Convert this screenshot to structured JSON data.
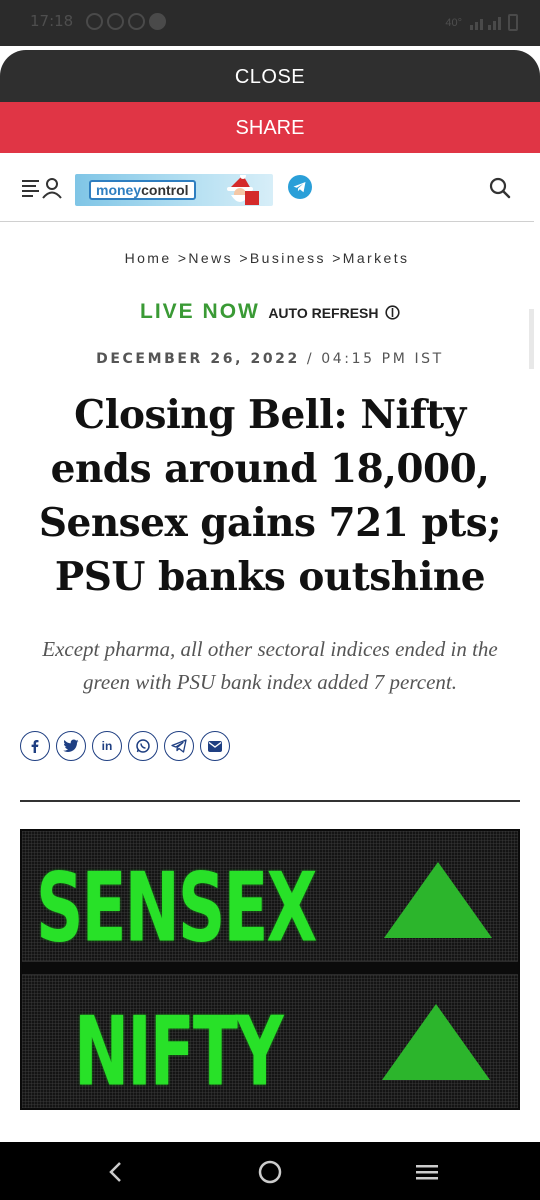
{
  "status_bar": {
    "time": "17:18",
    "network": "40°",
    "icons": [
      "whatsapp-icon",
      "apps-icon",
      "instagram-icon",
      "android-icon"
    ]
  },
  "overlay": {
    "close_label": "CLOSE",
    "share_label": "SHARE",
    "share_color": "#e03545"
  },
  "header": {
    "logo_text_money": "money",
    "logo_text_control": "control",
    "accent_color": "#2e7ec0"
  },
  "article": {
    "breadcrumb": [
      "Home",
      "News",
      "Business",
      "Markets"
    ],
    "live_label": "LIVE NOW",
    "auto_refresh_label": "AUTO REFRESH",
    "date": "DECEMBER 26, 2022",
    "time": "04:15 PM IST",
    "headline": "Closing Bell: Nifty ends around 18,000, Sensex gains 721 pts; PSU banks outshine",
    "subhead": "Except pharma, all other sectoral indices ended in the green with PSU bank index added 7 percent.",
    "share_icons": [
      "facebook-icon",
      "twitter-icon",
      "linkedin-icon",
      "whatsapp-icon",
      "telegram-icon",
      "email-icon"
    ],
    "hero": {
      "line1": "SENSEX",
      "line2": "NIFTY",
      "text_color": "#28e128"
    }
  },
  "nav_bar": {
    "icons": [
      "back-icon",
      "home-icon",
      "recent-apps-icon"
    ]
  }
}
